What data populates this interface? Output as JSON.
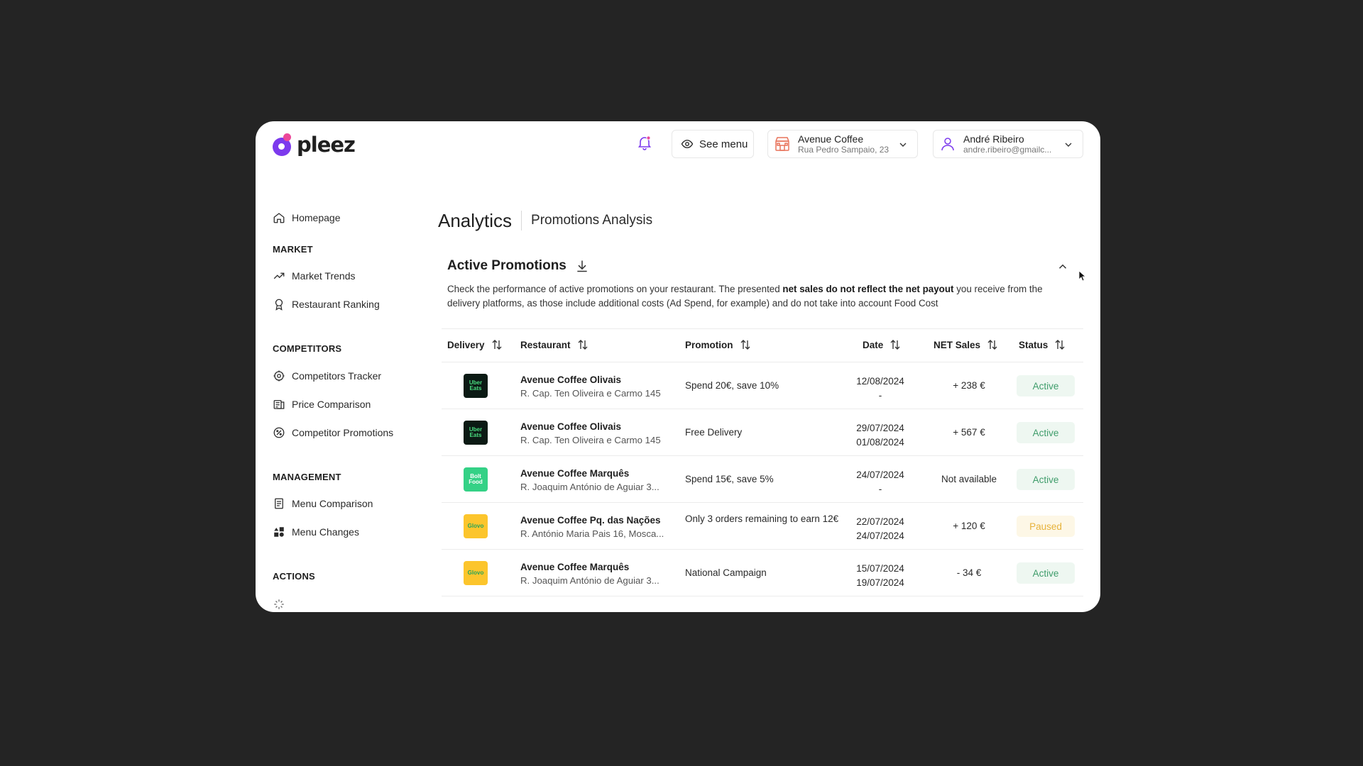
{
  "app": {
    "brand": "pleez",
    "colors": {
      "brand_purple": "#7c3aed",
      "brand_pink": "#ec4899",
      "active_green": "#3f9d6b",
      "paused_yellow": "#e7b23a"
    }
  },
  "header": {
    "notification_icon": "bell-icon",
    "see_menu_label": "See menu",
    "store": {
      "name": "Avenue Coffee",
      "address": "Rua Pedro Sampaio, 23"
    },
    "user": {
      "name": "André Ribeiro",
      "email": "andre.ribeiro@gmailc..."
    }
  },
  "sidebar": {
    "homepage": "Homepage",
    "sections": {
      "market": "MARKET",
      "competitors": "COMPETITORS",
      "management": "MANAGEMENT",
      "actions": "ACTIONS"
    },
    "items": {
      "market_trends": "Market Trends",
      "restaurant_ranking": "Restaurant Ranking",
      "competitors_tracker": "Competitors Tracker",
      "price_comparison": "Price Comparison",
      "competitor_promotions": "Competitor Promotions",
      "menu_comparison": "Menu Comparison",
      "menu_changes": "Menu Changes"
    }
  },
  "main": {
    "title": "Analytics",
    "subtitle": "Promotions Analysis",
    "section_title": "Active Promotions",
    "description_part1": "Check the performance of active promotions on your restaurant. The presented ",
    "description_bold": "net sales do not reflect the net payout",
    "description_part2": " you receive from the delivery platforms, as those include additional costs (Ad Spend, for example) and do not take into account Food Cost",
    "columns": {
      "delivery": "Delivery",
      "restaurant": "Restaurant",
      "promotion": "Promotion",
      "date": "Date",
      "net_sales": "NET Sales",
      "status": "Status"
    },
    "rows": [
      {
        "platform": "Uber Eats",
        "platform_text": "Uber\nEats",
        "restaurant": "Avenue Coffee Olivais",
        "address": "R. Cap. Ten Oliveira e Carmo 145",
        "promotion": "Spend 20€, save 10%",
        "date_start": "12/08/2024",
        "date_end": "-",
        "net_sales": "+ 238 €",
        "status": "Active"
      },
      {
        "platform": "Uber Eats",
        "platform_text": "Uber\nEats",
        "restaurant": "Avenue Coffee Olivais",
        "address": "R. Cap. Ten Oliveira e Carmo 145",
        "promotion": "Free Delivery",
        "date_start": "29/07/2024",
        "date_end": "01/08/2024",
        "net_sales": "+ 567 €",
        "status": "Active"
      },
      {
        "platform": "Bolt Food",
        "platform_text": "Bolt\nFood",
        "restaurant": "Avenue Coffee Marquês",
        "address": "R. Joaquim António de Aguiar 3...",
        "promotion": "Spend 15€, save 5%",
        "date_start": "24/07/2024",
        "date_end": "-",
        "net_sales": "Not available",
        "status": "Active"
      },
      {
        "platform": "Glovo",
        "platform_text": "Glovo",
        "restaurant": "Avenue Coffee Pq. das Nações",
        "address": "R. António Maria Pais 16, Mosca...",
        "promotion": "Only 3 orders remaining to earn 12€",
        "date_start": "22/07/2024",
        "date_end": "24/07/2024",
        "net_sales": "+ 120 €",
        "status": "Paused"
      },
      {
        "platform": "Glovo",
        "platform_text": "Glovo",
        "restaurant": "Avenue Coffee Marquês",
        "address": "R. Joaquim António de Aguiar 3...",
        "promotion": "National Campaign",
        "date_start": "15/07/2024",
        "date_end": "19/07/2024",
        "net_sales": "- 34 €",
        "status": "Active"
      }
    ]
  }
}
